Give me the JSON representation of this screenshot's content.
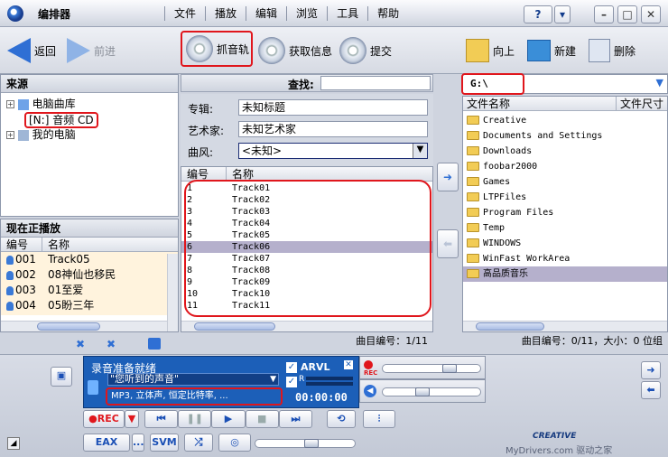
{
  "app": {
    "title": "编排器"
  },
  "menu": [
    "文件",
    "播放",
    "编辑",
    "浏览",
    "工具",
    "帮助"
  ],
  "window_buttons": {
    "help": "?",
    "dropdown": "▾"
  },
  "toolbar": {
    "back": "返回",
    "forward": "前进",
    "rip": "抓音轨",
    "get_info": "获取信息",
    "submit": "提交",
    "up": "向上",
    "new": "新建",
    "delete": "删除"
  },
  "source": {
    "header": "来源",
    "tree": [
      "电脑曲库",
      "[N:] 音频 CD",
      "我的电脑"
    ]
  },
  "now_playing": {
    "header": "现在正播放",
    "columns": [
      "编号",
      "名称"
    ],
    "rows": [
      {
        "num": "001",
        "name": "Track05"
      },
      {
        "num": "002",
        "name": "08神仙也移民"
      },
      {
        "num": "003",
        "name": "01至爱"
      },
      {
        "num": "004",
        "name": "05盼三年"
      }
    ]
  },
  "cd_panel": {
    "find_label": "查找:",
    "album_label": "专辑:",
    "album_value": "未知标题",
    "artist_label": "艺术家:",
    "artist_value": "未知艺术家",
    "genre_label": "曲风:",
    "genre_value": "<未知>",
    "columns": [
      "编号",
      "名称"
    ],
    "tracks": [
      {
        "num": "1",
        "name": "Track01"
      },
      {
        "num": "2",
        "name": "Track02"
      },
      {
        "num": "3",
        "name": "Track03"
      },
      {
        "num": "4",
        "name": "Track04"
      },
      {
        "num": "5",
        "name": "Track05"
      },
      {
        "num": "6",
        "name": "Track06"
      },
      {
        "num": "7",
        "name": "Track07"
      },
      {
        "num": "8",
        "name": "Track08"
      },
      {
        "num": "9",
        "name": "Track09"
      },
      {
        "num": "10",
        "name": "Track10"
      },
      {
        "num": "11",
        "name": "Track11"
      }
    ],
    "selected_index": 5,
    "status": "曲目编号：1/11"
  },
  "files": {
    "path": "G:\\",
    "columns": [
      "文件名称",
      "文件尺寸"
    ],
    "items": [
      "Creative",
      "Documents and Settings",
      "Downloads",
      "foobar2000",
      "Games",
      "LTPFiles",
      "Program Files",
      "Temp",
      "WINDOWS",
      "WinFast WorkArea",
      "高品质音乐"
    ],
    "selected_index": 10,
    "status": "曲目编号：0/11，大小：0 位组"
  },
  "player": {
    "status_line": "录音准备就绪",
    "source": "\"您听到的声音\"",
    "format": "MP3, 立体声, 恒定比特率, ...",
    "format_more": "...",
    "arvl": "ARVL",
    "r_label": "R",
    "time": "00:00:00",
    "rec_small": "REC",
    "rec_button": "●REC",
    "svm": "SVM",
    "eax": "EAX",
    "ellipsis": "...",
    "brand": "CREATIVE",
    "watermark": "MyDrivers.com 驱动之家"
  },
  "colors": {
    "accent": "#2f6fd4",
    "highlight": "#e0161c",
    "selection": "#b5b0cc",
    "lcd": "#1c5fb8"
  }
}
